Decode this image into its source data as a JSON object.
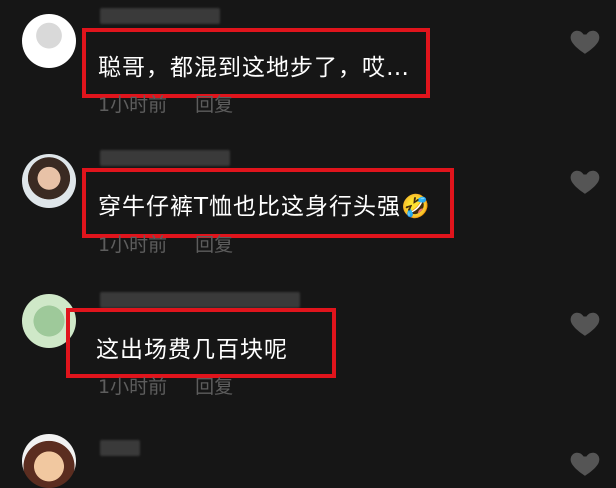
{
  "comments": [
    {
      "text": "聪哥，都混到这地步了，哎…",
      "time": "1小时前",
      "reply": "回复"
    },
    {
      "text": "穿牛仔裤T恤也比这身行头强🤣",
      "time": "1小时前",
      "reply": "回复"
    },
    {
      "text": "这出场费几百块呢",
      "time": "1小时前",
      "reply": "回复"
    }
  ],
  "colors": {
    "background": "#161616",
    "highlight": "#e0141c",
    "text": "#ffffff",
    "meta": "#5d5d5d",
    "heart": "#555555"
  },
  "icons": {
    "like": "heart-icon"
  }
}
